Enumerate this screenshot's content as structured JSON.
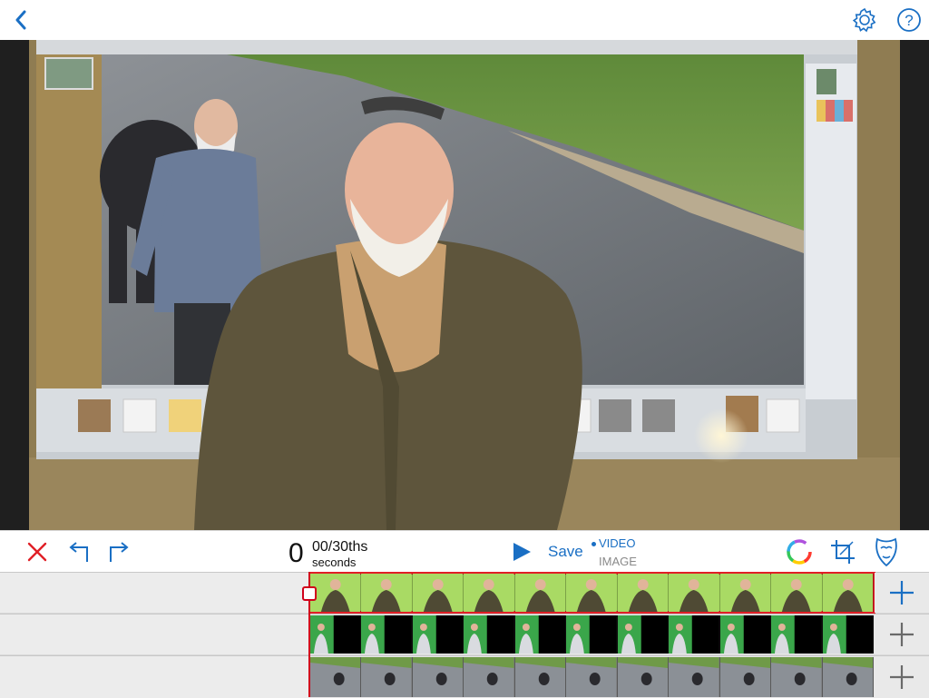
{
  "colors": {
    "accent": "#1a6fc4",
    "delete": "#e01f26",
    "playhead": "#d0021b",
    "track_green": "#9fd35a",
    "track_chroma": "#3aa64a"
  },
  "topbar": {
    "back_icon": "chevron-left-icon",
    "settings_icon": "gear-icon",
    "help_icon": "question-circle-icon",
    "help_glyph": "?"
  },
  "toolbar": {
    "delete_icon": "close-icon",
    "undo_icon": "undo-icon",
    "redo_icon": "redo-icon",
    "time_seconds": "0",
    "time_frames": "00",
    "time_unit": "/30ths",
    "time_caption": "seconds",
    "play_icon": "play-icon",
    "save_label": "Save",
    "mode_video": "VIDEO",
    "mode_image": "IMAGE",
    "color_icon": "color-wheel-icon",
    "crop_icon": "crop-icon",
    "mask_icon": "mask-icon"
  },
  "tracks": [
    {
      "kind": "person-green",
      "add_icon": "plus-icon",
      "selected": true
    },
    {
      "kind": "person-chroma",
      "add_icon": "plus-icon",
      "selected": false
    },
    {
      "kind": "road-elephant",
      "add_icon": "plus-icon",
      "selected": false
    }
  ]
}
